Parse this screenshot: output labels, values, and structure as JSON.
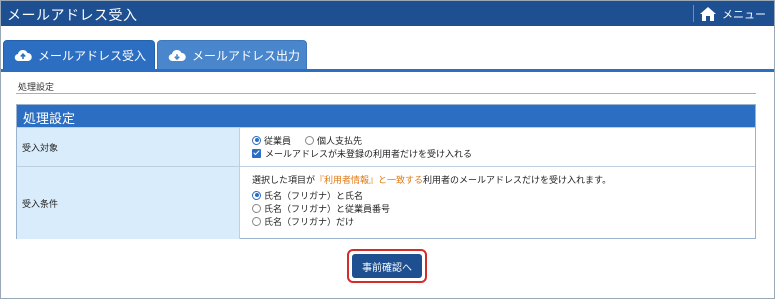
{
  "window": {
    "title": "メールアドレス受入"
  },
  "header": {
    "menu_label": "メニュー"
  },
  "tabs": [
    {
      "label": "メールアドレス受入",
      "active": true
    },
    {
      "label": "メールアドレス出力",
      "active": false
    }
  ],
  "section": {
    "label": "処理設定"
  },
  "panel": {
    "title": "処理設定",
    "rows": [
      {
        "label": "受入対象",
        "options": [
          {
            "label": "従業員",
            "selected": true
          },
          {
            "label": "個人支払先",
            "selected": false
          }
        ],
        "checkbox": {
          "label": "メールアドレスが未登録の利用者だけを受け入れる",
          "checked": true
        }
      },
      {
        "label": "受入条件",
        "description_prefix": "選択した項目が",
        "description_highlight": "『利用者情報』と一致する",
        "description_suffix": "利用者のメールアドレスだけを受け入れます。",
        "options": [
          {
            "label": "氏名（フリガナ）と氏名",
            "selected": true
          },
          {
            "label": "氏名（フリガナ）と従業員番号",
            "selected": false
          },
          {
            "label": "氏名（フリガナ）だけ",
            "selected": false
          }
        ]
      }
    ]
  },
  "actions": {
    "confirm_label": "事前確認へ"
  },
  "colors": {
    "primary": "#2c6fc2",
    "header": "#1d4f91",
    "highlight": "#e07a14",
    "focus_ring": "#d62b2b"
  }
}
